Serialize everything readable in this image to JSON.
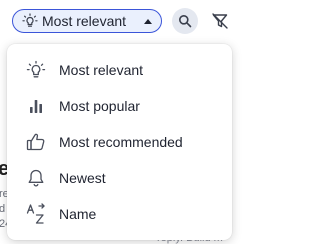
{
  "background": {
    "heading_fragment": "e",
    "line_fragments": [
      "re",
      "d s",
      "24"
    ],
    "bottom_fragment": "reply. Build m"
  },
  "toolbar": {
    "sort_selected": "Most relevant",
    "sort_icon": "lightbulb-icon",
    "search_icon": "search-icon",
    "filter_icon": "filter-off-icon"
  },
  "sort_menu": {
    "items": [
      {
        "label": "Most relevant",
        "icon": "lightbulb-icon"
      },
      {
        "label": "Most popular",
        "icon": "bar-chart-icon"
      },
      {
        "label": "Most recommended",
        "icon": "thumbs-up-icon"
      },
      {
        "label": "Newest",
        "icon": "bell-icon"
      },
      {
        "label": "Name",
        "icon": "sort-az-icon"
      }
    ]
  },
  "colors": {
    "accent": "#3b55d9",
    "select_bg": "#eaf0fd",
    "icon": "#4a4f5c"
  }
}
